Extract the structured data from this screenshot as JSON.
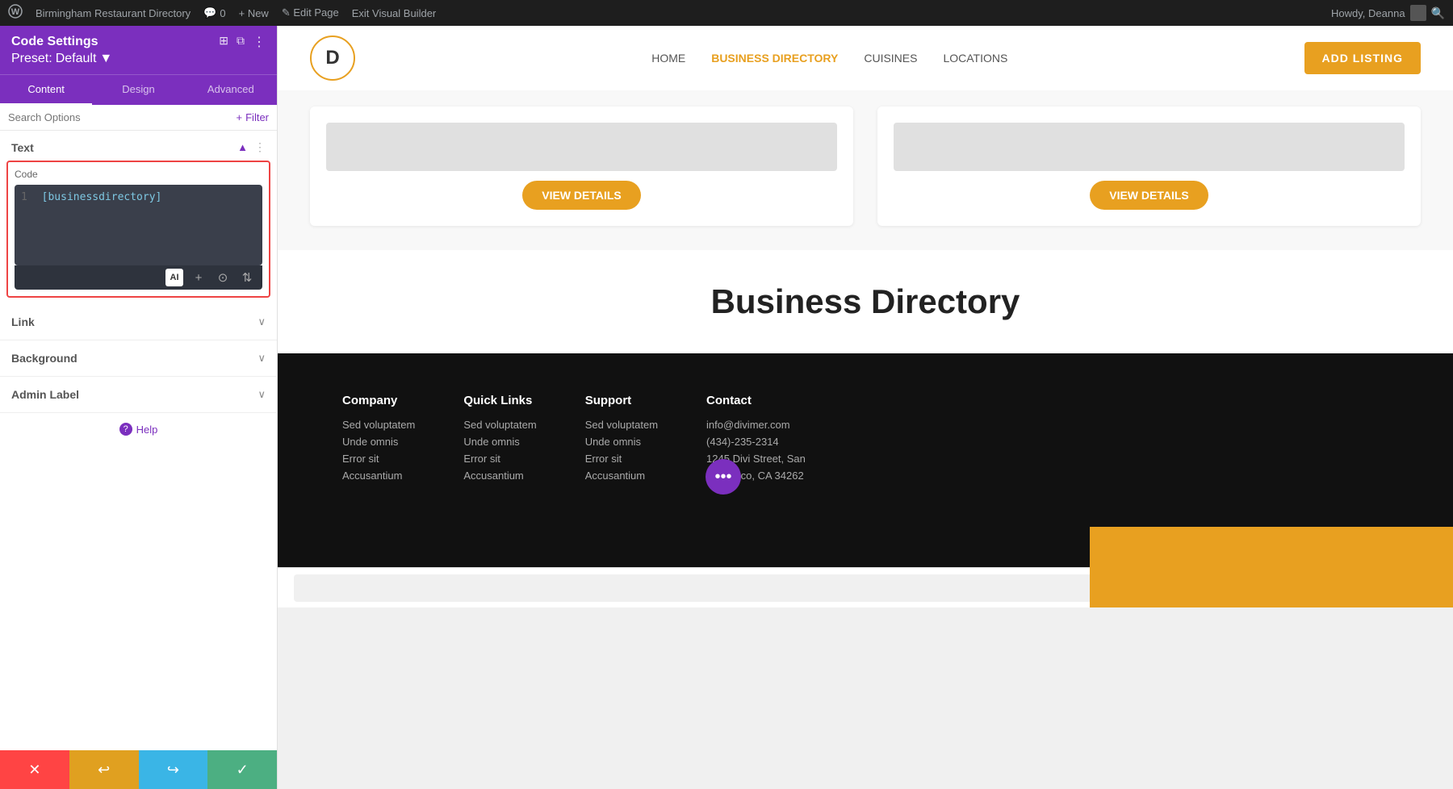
{
  "admin_bar": {
    "wp_logo": "⊕",
    "site_name": "Birmingham Restaurant Directory",
    "comments_icon": "💬",
    "comments_count": "0",
    "new_label": "+ New",
    "edit_page_label": "✎ Edit Page",
    "exit_builder_label": "Exit Visual Builder",
    "howdy_text": "Howdy, Deanna",
    "search_icon": "🔍"
  },
  "sidebar": {
    "title": "Code Settings",
    "preset_label": "Preset:",
    "preset_name": "Default",
    "preset_arrow": "▼",
    "icon1": "⊞",
    "icon2": "⧉",
    "icon3": "⋮",
    "tabs": [
      {
        "label": "Content",
        "active": true
      },
      {
        "label": "Design",
        "active": false
      },
      {
        "label": "Advanced",
        "active": false
      }
    ],
    "search_placeholder": "Search Options",
    "filter_label": "+ Filter",
    "sections": {
      "text": {
        "title": "Text",
        "code_label": "Code",
        "code_line_num": "1",
        "code_content": "[businessdirectory]",
        "toolbar": {
          "ai_icon": "AI",
          "plus_icon": "+",
          "circle_icon": "⊙",
          "arrows_icon": "⇅"
        }
      },
      "link": {
        "title": "Link"
      },
      "background": {
        "title": "Background"
      },
      "admin_label": {
        "title": "Admin Label"
      }
    },
    "help_label": "Help"
  },
  "bottom_bar": {
    "cancel_icon": "✕",
    "undo_icon": "↩",
    "redo_icon": "↪",
    "save_icon": "✓"
  },
  "website": {
    "logo_letter": "D",
    "nav_links": [
      {
        "label": "HOME",
        "active": false
      },
      {
        "label": "BUSINESS DIRECTORY",
        "active": true
      },
      {
        "label": "CUISINES",
        "active": false
      },
      {
        "label": "LOCATIONS",
        "active": false
      }
    ],
    "add_listing_btn": "ADD LISTING",
    "cards": [
      {
        "view_details": "VIEW DETAILS"
      },
      {
        "view_details": "VIEW DETAILS"
      }
    ],
    "business_directory_title": "Business Directory",
    "footer": {
      "columns": [
        {
          "title": "Company",
          "links": [
            "Sed voluptatem",
            "Unde omnis",
            "Error sit",
            "Accusantium"
          ]
        },
        {
          "title": "Quick Links",
          "links": [
            "Sed voluptatem",
            "Unde omnis",
            "Error sit",
            "Accusantium"
          ]
        },
        {
          "title": "Support",
          "links": [
            "Sed voluptatem",
            "Unde omnis",
            "Error sit",
            "Accusantium"
          ]
        },
        {
          "title": "Contact",
          "links": [
            "info@divimer.com",
            "(434)-235-2314",
            "1245 Divi Street, San",
            "Francisco, CA 34262"
          ]
        }
      ]
    }
  }
}
